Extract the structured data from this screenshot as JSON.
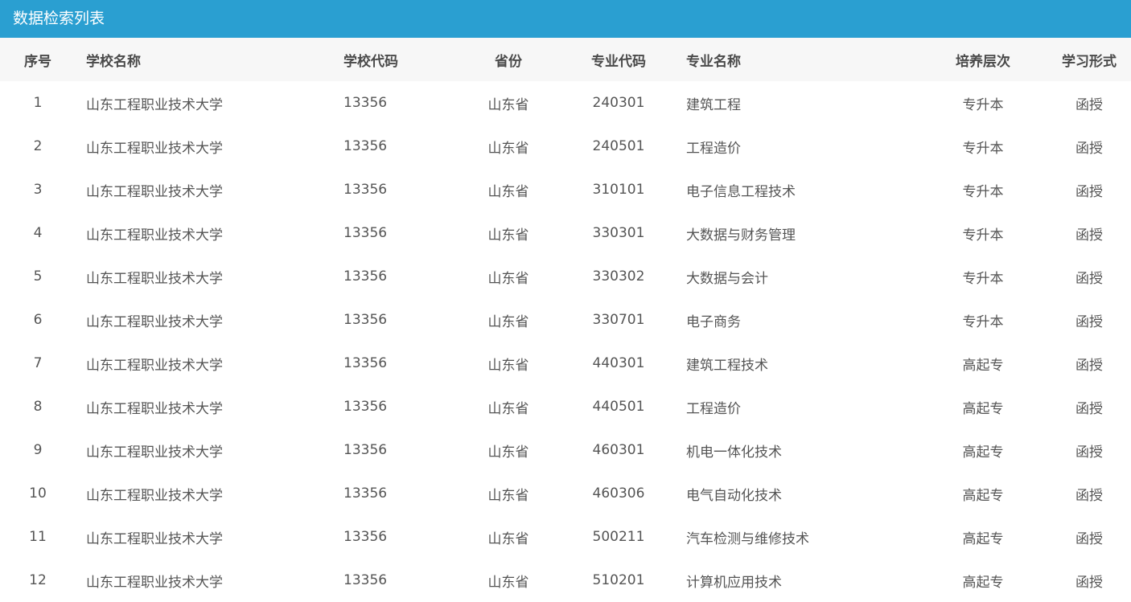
{
  "header": {
    "title": "数据检索列表"
  },
  "table": {
    "columns": [
      "序号",
      "学校名称",
      "学校代码",
      "省份",
      "专业代码",
      "专业名称",
      "培养层次",
      "学习形式"
    ],
    "rows": [
      [
        "1",
        "山东工程职业技术大学",
        "13356",
        "山东省",
        "240301",
        "建筑工程",
        "专升本",
        "函授"
      ],
      [
        "2",
        "山东工程职业技术大学",
        "13356",
        "山东省",
        "240501",
        "工程造价",
        "专升本",
        "函授"
      ],
      [
        "3",
        "山东工程职业技术大学",
        "13356",
        "山东省",
        "310101",
        "电子信息工程技术",
        "专升本",
        "函授"
      ],
      [
        "4",
        "山东工程职业技术大学",
        "13356",
        "山东省",
        "330301",
        "大数据与财务管理",
        "专升本",
        "函授"
      ],
      [
        "5",
        "山东工程职业技术大学",
        "13356",
        "山东省",
        "330302",
        "大数据与会计",
        "专升本",
        "函授"
      ],
      [
        "6",
        "山东工程职业技术大学",
        "13356",
        "山东省",
        "330701",
        "电子商务",
        "专升本",
        "函授"
      ],
      [
        "7",
        "山东工程职业技术大学",
        "13356",
        "山东省",
        "440301",
        "建筑工程技术",
        "高起专",
        "函授"
      ],
      [
        "8",
        "山东工程职业技术大学",
        "13356",
        "山东省",
        "440501",
        "工程造价",
        "高起专",
        "函授"
      ],
      [
        "9",
        "山东工程职业技术大学",
        "13356",
        "山东省",
        "460301",
        "机电一体化技术",
        "高起专",
        "函授"
      ],
      [
        "10",
        "山东工程职业技术大学",
        "13356",
        "山东省",
        "460306",
        "电气自动化技术",
        "高起专",
        "函授"
      ],
      [
        "11",
        "山东工程职业技术大学",
        "13356",
        "山东省",
        "500211",
        "汽车检测与维修技术",
        "高起专",
        "函授"
      ],
      [
        "12",
        "山东工程职业技术大学",
        "13356",
        "山东省",
        "510201",
        "计算机应用技术",
        "高起专",
        "函授"
      ]
    ]
  }
}
